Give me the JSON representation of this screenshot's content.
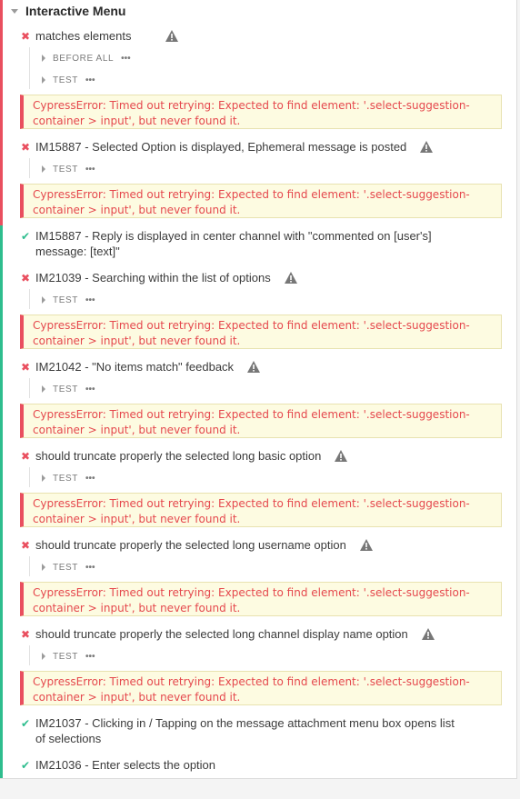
{
  "suite": {
    "title": "Interactive Menu"
  },
  "hooks": {
    "before_all": "BEFORE ALL",
    "test": "TEST",
    "more": "•••"
  },
  "error_text": "CypressError: Timed out retrying: Expected to find element: '.select-suggestion-\ncontainer > input', but never found it.",
  "tests": [
    {
      "title": "matches elements",
      "status": "failed"
    },
    {
      "title": "IM15887 - Selected Option is displayed, Ephemeral message is posted",
      "status": "failed"
    },
    {
      "title": "IM15887 - Reply is displayed in center channel with \"commented on [user's]\nmessage: [text]\"",
      "status": "passed"
    },
    {
      "title": "IM21039 - Searching within the list of options",
      "status": "failed"
    },
    {
      "title": "IM21042 - \"No items match\" feedback",
      "status": "failed"
    },
    {
      "title": "should truncate properly the selected long basic option",
      "status": "failed"
    },
    {
      "title": "should truncate properly the selected long username option",
      "status": "failed"
    },
    {
      "title": "should truncate properly the selected long channel display name option",
      "status": "failed"
    },
    {
      "title": "IM21037 - Clicking in / Tapping on the message attachment menu box opens list\nof selections",
      "status": "passed"
    },
    {
      "title": "IM21036 - Enter selects the option",
      "status": "passed"
    }
  ],
  "colors": {
    "fail": "#e94f5f",
    "pass": "#2ebd8e",
    "error_bg": "#fdfbe1",
    "error_text": "#e5484d"
  },
  "icons": {
    "fail": "cross-icon",
    "pass": "check-icon",
    "warning": "warning-triangle-icon",
    "collapse": "caret-down-icon",
    "expand": "caret-right-icon"
  }
}
